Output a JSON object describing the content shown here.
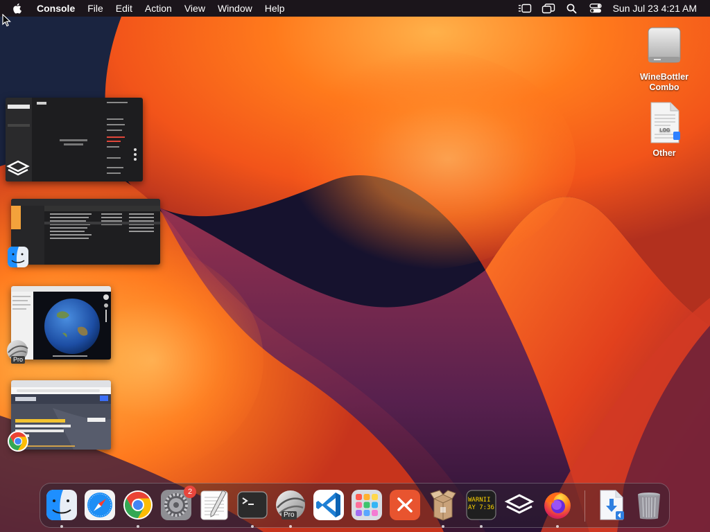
{
  "menubar": {
    "app_name": "Console",
    "menus": [
      "File",
      "Edit",
      "Action",
      "View",
      "Window",
      "Help"
    ],
    "clock": "Sun Jul 23  4:21 AM",
    "status_icons": [
      "stage-manager-icon",
      "screen-mirroring-icon",
      "spotlight-icon",
      "control-center-icon"
    ]
  },
  "desktop_icons": [
    {
      "label": "WineBottler Combo",
      "label_lines": [
        "WineBottler",
        "Combo"
      ],
      "icon": "drive-icon"
    },
    {
      "label": "Other",
      "icon": "log-file-icon",
      "file_tag": "LOG"
    }
  ],
  "stage_manager": [
    {
      "app": "Parallels Toolbox",
      "icon": "parallels-toolbox-icon"
    },
    {
      "app": "Finder",
      "icon": "finder-icon"
    },
    {
      "app": "Google Earth Pro",
      "icon": "google-earth-pro-icon",
      "badge": "Pro"
    },
    {
      "app": "Google Chrome",
      "icon": "chrome-icon"
    }
  ],
  "dock": {
    "items": [
      {
        "name": "Finder",
        "icon": "finder-icon",
        "running": true
      },
      {
        "name": "Safari",
        "icon": "safari-icon",
        "running": false
      },
      {
        "name": "Google Chrome",
        "icon": "chrome-icon",
        "running": true
      },
      {
        "name": "System Settings",
        "icon": "system-settings-icon",
        "running": false,
        "badge": "2"
      },
      {
        "name": "TextEdit",
        "icon": "textedit-icon",
        "running": false
      },
      {
        "name": "Terminal",
        "icon": "terminal-icon",
        "running": true
      },
      {
        "name": "Google Earth Pro",
        "icon": "google-earth-pro-icon",
        "running": true,
        "badge_text": "Pro"
      },
      {
        "name": "Visual Studio Code",
        "icon": "vscode-icon",
        "running": false
      },
      {
        "name": "Launchpad",
        "icon": "launchpad-icon",
        "running": false
      },
      {
        "name": "Remote Desktop",
        "icon": "remote-desktop-icon",
        "running": false
      },
      {
        "name": "Archive Utility",
        "icon": "package-icon",
        "running": true
      },
      {
        "name": "Console",
        "icon": "console-icon",
        "running": true,
        "console_lines": [
          "WARNII",
          "AY 7:36"
        ]
      },
      {
        "name": "Parallels Toolbox",
        "icon": "parallels-toolbox-icon",
        "running": false
      },
      {
        "name": "Firefox",
        "icon": "firefox-icon",
        "running": true
      },
      {
        "name": "Downloads",
        "icon": "downloads-folder-icon",
        "running": false
      },
      {
        "name": "Trash",
        "icon": "trash-icon",
        "running": false
      }
    ]
  },
  "colors": {
    "wallpaper_orange": "#ff6a1a",
    "wallpaper_dark": "#2a0d2e",
    "badge_red": "#e8453c",
    "menubar_bg": "#1c161a"
  }
}
